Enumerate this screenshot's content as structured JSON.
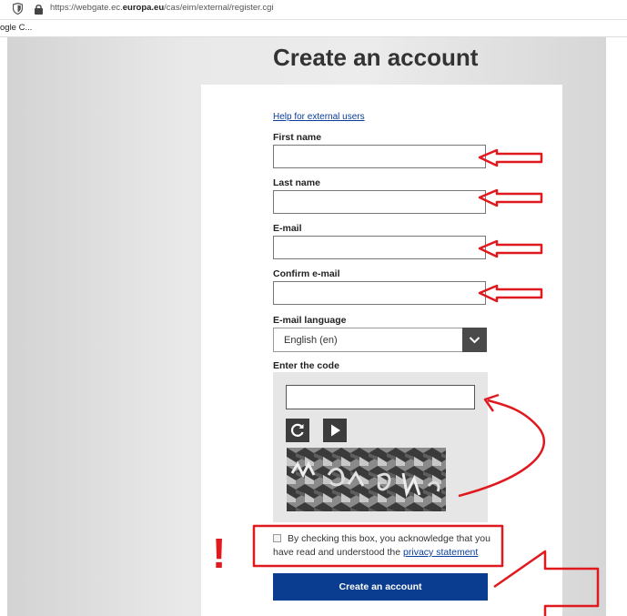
{
  "browser": {
    "url_prefix": "https://webgate.ec.",
    "url_domain": "europa.eu",
    "url_path": "/cas/eim/external/register.cgi",
    "bookmark": "ogle C..."
  },
  "page": {
    "title": "Create an account",
    "help_link": "Help for external users"
  },
  "form": {
    "first_name_label": "First name",
    "first_name_value": "",
    "last_name_label": "Last name",
    "last_name_value": "",
    "email_label": "E-mail",
    "email_value": "",
    "confirm_email_label": "Confirm e-mail",
    "confirm_email_value": "",
    "language_label": "E-mail language",
    "language_value": "English (en)",
    "code_label": "Enter the code",
    "code_value": "",
    "checkbox_text_1": "By checking this box, you acknowledge that you",
    "checkbox_text_2": "have read and understood the",
    "privacy_link": "privacy statement",
    "submit_label": "Create an account"
  },
  "annotations": {
    "exclamation": "!",
    "color": "#e0191f"
  },
  "colors": {
    "primary_button": "#0a3d8f",
    "link": "#0a3d9c"
  }
}
